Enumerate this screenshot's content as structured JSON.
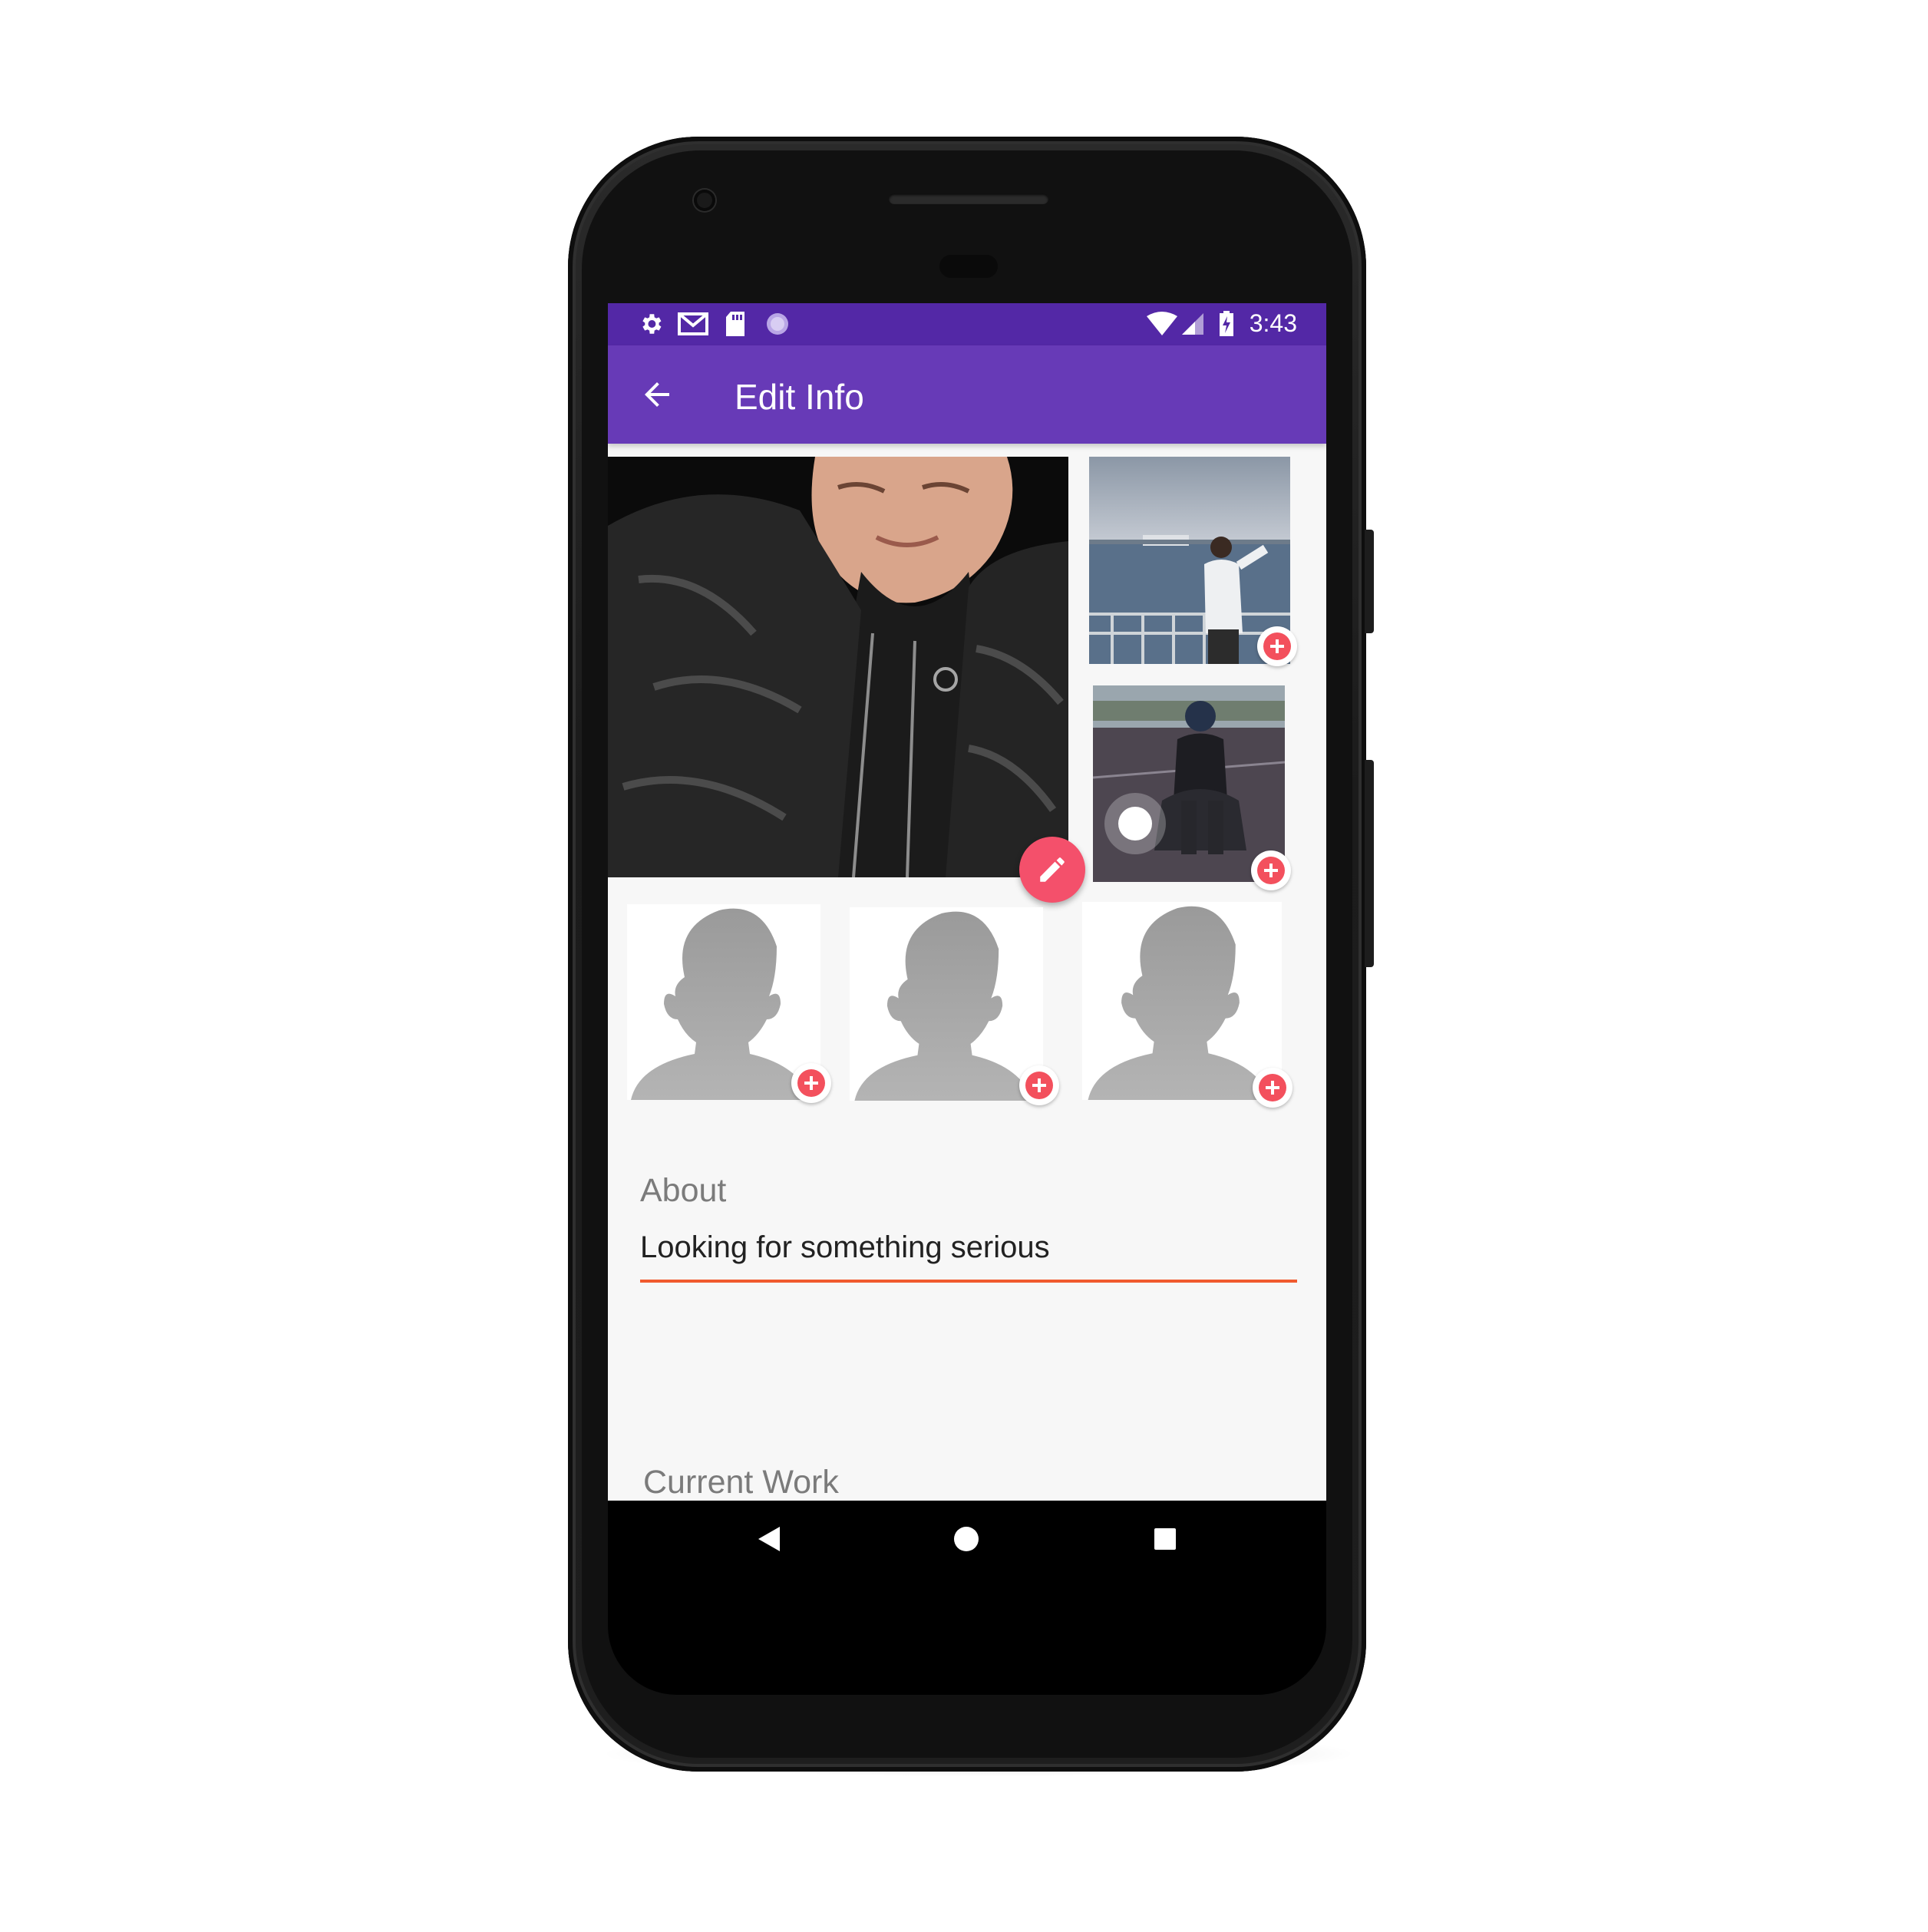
{
  "status_bar": {
    "time": "3:43",
    "left_icons": [
      "gear-icon",
      "gmail-icon",
      "sd-card-icon",
      "sync-dot-icon"
    ],
    "right_icons": [
      "wifi-icon",
      "signal-icon",
      "battery-charging-icon"
    ]
  },
  "app_bar": {
    "title": "Edit Info",
    "back_icon": "arrow-left-icon"
  },
  "photos": {
    "main": {
      "description_icon": "profile-photo",
      "edit_icon": "pencil-icon"
    },
    "slots": [
      {
        "filled": true,
        "add_icon": "plus-icon"
      },
      {
        "filled": true,
        "add_icon": "plus-icon"
      },
      {
        "filled": false,
        "add_icon": "plus-icon"
      },
      {
        "filled": false,
        "add_icon": "plus-icon"
      },
      {
        "filled": false,
        "add_icon": "plus-icon"
      }
    ]
  },
  "about": {
    "label": "About",
    "value": "Looking for something serious"
  },
  "current_work": {
    "label": "Current Work"
  },
  "colors": {
    "status_bar": "#5328a6",
    "app_bar": "#673ab7",
    "accent": "#f3505d",
    "fab": "#f4506b",
    "underline": "#f05a2e",
    "background": "#f7f7f7"
  },
  "nav_bar": {
    "icons": [
      "back-triangle-icon",
      "home-circle-icon",
      "recents-square-icon"
    ]
  }
}
